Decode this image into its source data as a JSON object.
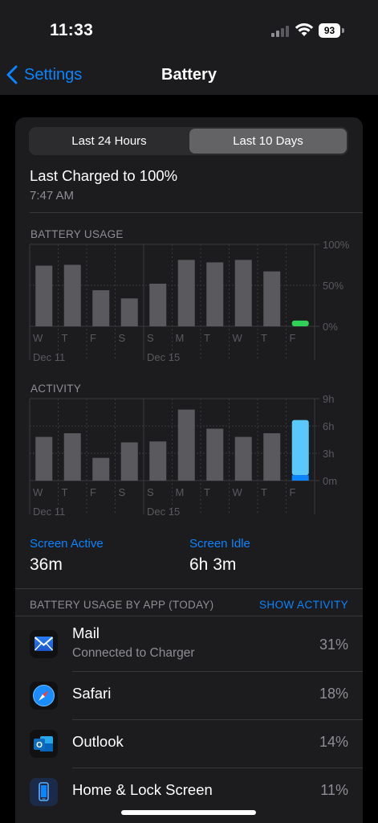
{
  "status_bar": {
    "time": "11:33",
    "battery_level": "93"
  },
  "nav": {
    "back_label": "Settings",
    "title": "Battery"
  },
  "segmented": {
    "options": [
      "Last 24 Hours",
      "Last 10 Days"
    ],
    "selected": "Last 10 Days"
  },
  "last_charged": {
    "title": "Last Charged to 100%",
    "time": "7:47 AM"
  },
  "colors": {
    "accent": "#0a84ff",
    "bar": "#5a5a5e",
    "battery_green": "#30d158",
    "activity_light": "#5ac8fa",
    "activity_dark": "#0a84ff"
  },
  "chart_data": [
    {
      "type": "bar",
      "title": "BATTERY USAGE",
      "categories": [
        "W",
        "T",
        "F",
        "S",
        "S",
        "M",
        "T",
        "W",
        "T",
        "F"
      ],
      "values": [
        74,
        75,
        44,
        34,
        52,
        81,
        78,
        81,
        67,
        7
      ],
      "highlight_last": true,
      "y_ticks": [
        "100%",
        "50%",
        "0%"
      ],
      "ylim": [
        0,
        100
      ],
      "date_labels": [
        "Dec 11",
        "Dec 15"
      ]
    },
    {
      "type": "bar",
      "title": "ACTIVITY",
      "categories": [
        "W",
        "T",
        "F",
        "S",
        "S",
        "M",
        "T",
        "W",
        "T",
        "F"
      ],
      "series": [
        {
          "name": "Screen Active",
          "values": [
            0,
            0,
            0,
            0,
            0,
            0,
            0,
            0,
            0,
            0.6
          ]
        },
        {
          "name": "Screen Idle",
          "values": [
            4.8,
            5.2,
            2.5,
            4.2,
            4.3,
            7.8,
            5.7,
            4.8,
            5.2,
            6.05
          ]
        }
      ],
      "y_ticks": [
        "9h",
        "6h",
        "3h",
        "0m"
      ],
      "ylim": [
        0,
        9
      ],
      "date_labels": [
        "Dec 11",
        "Dec 15"
      ]
    }
  ],
  "screen_stats": {
    "active_label": "Screen Active",
    "active_value": "36m",
    "idle_label": "Screen Idle",
    "idle_value": "6h 3m"
  },
  "usage_by_app": {
    "header": "BATTERY USAGE BY APP (TODAY)",
    "show_activity": "SHOW ACTIVITY",
    "apps": [
      {
        "name": "Mail",
        "subtitle": "Connected to Charger",
        "percent": "31%",
        "icon": "mail-icon"
      },
      {
        "name": "Safari",
        "subtitle": "",
        "percent": "18%",
        "icon": "safari-icon"
      },
      {
        "name": "Outlook",
        "subtitle": "",
        "percent": "14%",
        "icon": "outlook-icon"
      },
      {
        "name": "Home & Lock Screen",
        "subtitle": "",
        "percent": "11%",
        "icon": "home-lock-screen-icon"
      }
    ]
  }
}
